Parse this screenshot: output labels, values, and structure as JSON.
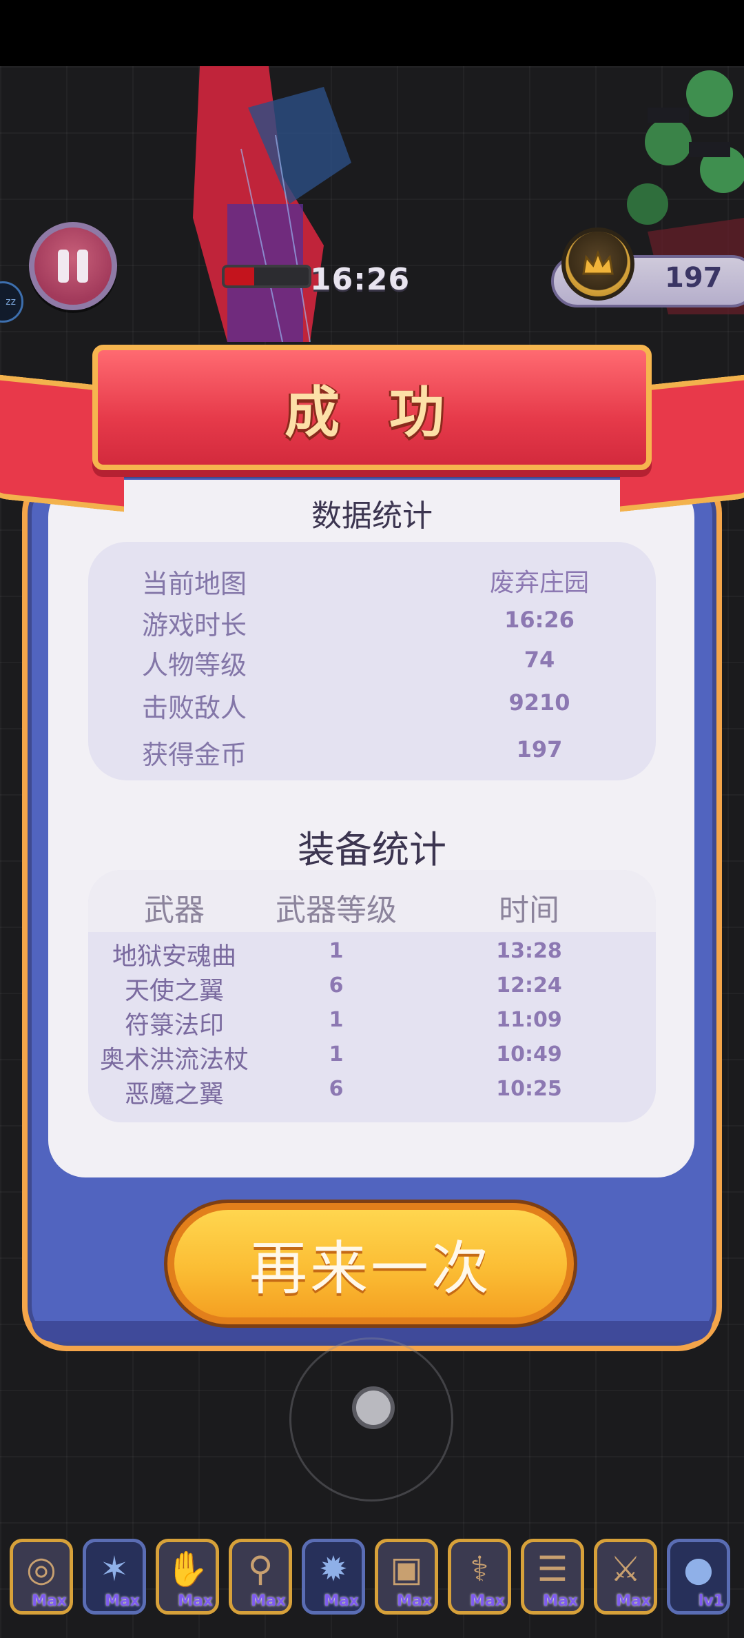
{
  "hud": {
    "timer": "16:26",
    "coins": "197",
    "hp_fraction": 0.35,
    "sleep_label": "zz"
  },
  "result": {
    "title": "成 功",
    "stats_title": "数据统计",
    "stats": [
      {
        "label": "当前地图",
        "value": "废弃庄园"
      },
      {
        "label": "游戏时长",
        "value": "16:26"
      },
      {
        "label": "人物等级",
        "value": "74"
      },
      {
        "label": "击败敌人",
        "value": "9210"
      },
      {
        "label": "获得金币",
        "value": "197"
      }
    ],
    "equip_title": "装备统计",
    "equip_headers": {
      "weapon": "武器",
      "level": "武器等级",
      "time": "时间"
    },
    "equipment": [
      {
        "name": "地狱安魂曲",
        "level": "1",
        "time": "13:28"
      },
      {
        "name": "天使之翼",
        "level": "6",
        "time": "12:24"
      },
      {
        "name": "符箓法印",
        "level": "1",
        "time": "11:09"
      },
      {
        "name": "奥术洪流法杖",
        "level": "1",
        "time": "10:49"
      },
      {
        "name": "恶魔之翼",
        "level": "6",
        "time": "10:25"
      }
    ],
    "retry_label": "再来一次"
  },
  "weapon_slots": [
    {
      "icon": "spiral-disc-icon",
      "tag": "Max",
      "style": "gold"
    },
    {
      "icon": "wings-icon",
      "tag": "Max",
      "style": "blue"
    },
    {
      "icon": "leather-glove-icon",
      "tag": "Max",
      "style": "gold"
    },
    {
      "icon": "magic-staff-icon",
      "tag": "Max",
      "style": "gold"
    },
    {
      "icon": "demon-wings-icon",
      "tag": "Max",
      "style": "blue"
    },
    {
      "icon": "stone-block-icon",
      "tag": "Max",
      "style": "gold"
    },
    {
      "icon": "crystal-staff-icon",
      "tag": "Max",
      "style": "gold"
    },
    {
      "icon": "scroll-icon",
      "tag": "Max",
      "style": "gold"
    },
    {
      "icon": "sword-icon",
      "tag": "Max",
      "style": "gold"
    },
    {
      "icon": "blue-orb-icon",
      "tag": "lv1",
      "style": "blue"
    }
  ],
  "colors": {
    "ribbon_red": "#e63a4a",
    "panel_blue": "#5164bf",
    "panel_border": "#f4a54a",
    "button_yellow": "#fbbd34",
    "value_purple": "#8c78b2"
  }
}
